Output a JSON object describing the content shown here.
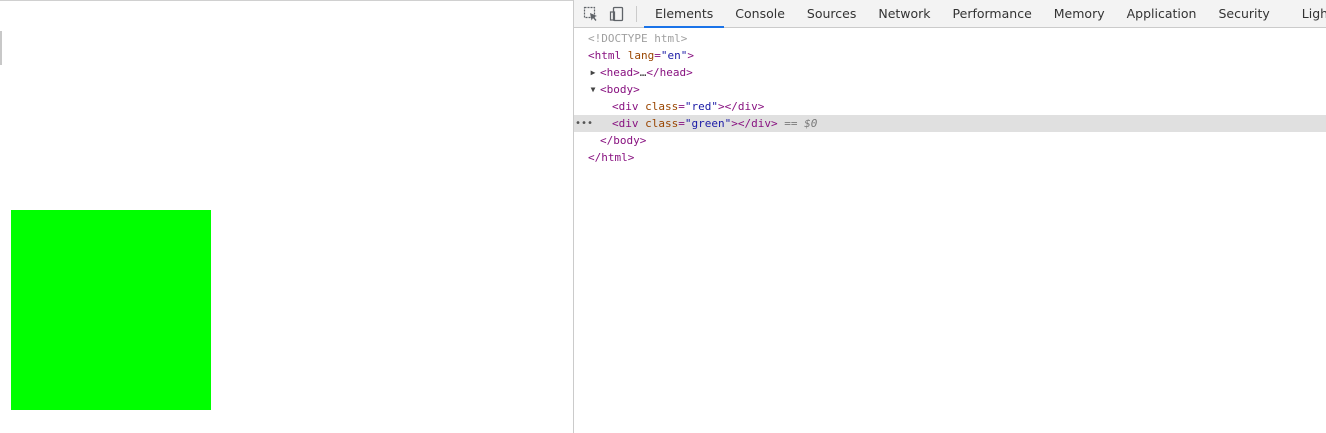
{
  "page_view": {
    "box_color": "#00ff00"
  },
  "devtools": {
    "tabs": [
      "Elements",
      "Console",
      "Sources",
      "Network",
      "Performance",
      "Memory",
      "Application",
      "Security",
      "Lighthouse"
    ],
    "active_tab": "Elements",
    "tree": {
      "doctype": "<!DOCTYPE html>",
      "html_open": "<html",
      "html_attr": "lang",
      "html_val": "\"en\"",
      "gt": ">",
      "head_open": "<head>",
      "head_ellipsis": "…",
      "head_close": "</head>",
      "body_open": "<body>",
      "div_open": "<div",
      "class_attr": "class",
      "red_val": "\"red\"",
      "green_val": "\"green\"",
      "div_close": "></div>",
      "selected_marker": "== $0",
      "row_dots": "•••",
      "body_close": "</body>",
      "html_close": "</html>"
    }
  }
}
